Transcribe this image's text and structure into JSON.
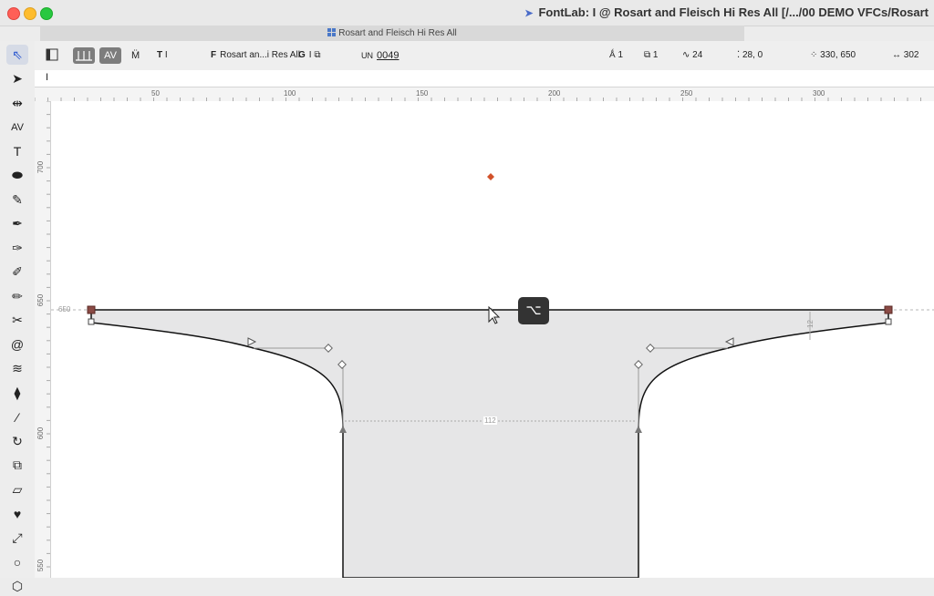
{
  "window": {
    "title": "FontLab: I @ Rosart and Fleisch Hi Res All [/.../00 DEMO VFCs/Rosart"
  },
  "tab": {
    "label": "Rosart and Fleisch Hi Res All"
  },
  "toolbox": {
    "tools": [
      {
        "name": "contour-tool-icon",
        "glyph": "⇖"
      },
      {
        "name": "element-tool-icon",
        "glyph": "➤"
      },
      {
        "name": "metrics-tool-icon",
        "glyph": "⇹"
      },
      {
        "name": "kerning-tool-icon",
        "glyph": "AV"
      },
      {
        "name": "text-tool-icon",
        "glyph": "T"
      },
      {
        "name": "eraser-tool-icon",
        "glyph": "⬬"
      },
      {
        "name": "brush-tool-icon",
        "glyph": "✎"
      },
      {
        "name": "pen-tool-icon",
        "glyph": "✒"
      },
      {
        "name": "rapid-tool-icon",
        "glyph": "✑"
      },
      {
        "name": "power-brush-icon",
        "glyph": "✐"
      },
      {
        "name": "pencil-tool-icon",
        "glyph": "✏"
      },
      {
        "name": "knife-tool-icon",
        "glyph": "✂"
      },
      {
        "name": "spiral-tool-icon",
        "glyph": "@"
      },
      {
        "name": "curves-tool-icon",
        "glyph": "≋"
      },
      {
        "name": "fill-tool-icon",
        "glyph": "⧫"
      },
      {
        "name": "ruler-tool-icon",
        "glyph": "⁄"
      },
      {
        "name": "rotate-tool-icon",
        "glyph": "↻"
      },
      {
        "name": "scale-tool-icon",
        "glyph": "⧉"
      },
      {
        "name": "slant-tool-icon",
        "glyph": "▱"
      },
      {
        "name": "heart-tool-icon",
        "glyph": "♥"
      },
      {
        "name": "eyedropper-tool-icon",
        "glyph": "⤢"
      },
      {
        "name": "ellipse-tool-icon",
        "glyph": "○"
      },
      {
        "name": "polygon-tool-icon",
        "glyph": "⬡"
      }
    ]
  },
  "propbar": {
    "av_label": "AV",
    "font_icon": "F",
    "font_name": "Rosart an...i Res All",
    "glyph_icon": "G",
    "glyph_name": "I",
    "unicode_icon": "UN",
    "unicode_value": "0049",
    "layers_count": "1",
    "elements_count": "1",
    "nodes_count": "24",
    "position": "28, 0",
    "size": "330, 650",
    "advance_width": "302"
  },
  "textbar": {
    "value": "I"
  },
  "ruler": {
    "h_labels": [
      "50",
      "100",
      "150",
      "200",
      "250",
      "300"
    ],
    "v_labels": [
      "700",
      "650",
      "600",
      "550"
    ]
  },
  "canvas": {
    "guide_label": "650",
    "stem_width_label": "112",
    "serif_height_label": "12",
    "modifier_key_glyph": "⌥"
  },
  "colors": {
    "glyph_fill": "#e6e6e7",
    "outline": "#111111",
    "anchor": "#d2512a",
    "selected_node": "#8a4a45"
  }
}
